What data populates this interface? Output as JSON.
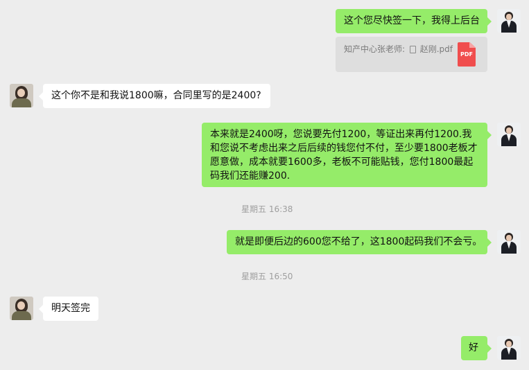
{
  "messages": [
    {
      "side": "right",
      "text": "这个您尽快签一下，我得上后台"
    },
    {
      "side": "right",
      "type": "quote",
      "sender": "知产中心张老师:",
      "file_name": "赵刚.pdf",
      "file_type": "PDF"
    },
    {
      "side": "left",
      "text": "这个你不是和我说1800嘛，合同里写的是2400?"
    },
    {
      "side": "right",
      "text": "本来就是2400呀，您说要先付1200，等证出来再付1200.我和您说不考虑出来之后后续的钱您付不付，至少要1800老板才愿意做，成本就要1600多，老板不可能贴钱，您付1800最起码我们还能赚200."
    },
    {
      "type": "time",
      "text": "星期五 16:38"
    },
    {
      "side": "right",
      "text": "就是即便后边的600您不给了，这1800起码我们不会亏。"
    },
    {
      "type": "time",
      "text": "星期五 16:50"
    },
    {
      "side": "left",
      "text": "明天签完"
    },
    {
      "side": "right",
      "text": "好"
    }
  ],
  "colors": {
    "background": "#ededed",
    "own_bubble": "#95ec69",
    "other_bubble": "#ffffff",
    "quote_bg": "#dedede",
    "pdf_icon": "#f04d4d"
  },
  "icons": {
    "own_avatar": "man-in-suit-avatar",
    "other_avatar": "woman-avatar",
    "file": "file-icon",
    "pdf": "pdf-file-icon"
  }
}
